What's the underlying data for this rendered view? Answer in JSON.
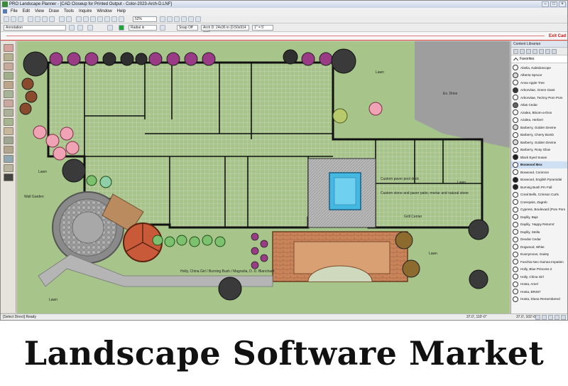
{
  "window": {
    "title": "PRO Landscape Planner - [CAD Closeup for Printed Output - Color-2023-Arch-D.LNF]",
    "controls": [
      "minimize-icon",
      "maximize-icon",
      "close-icon"
    ]
  },
  "menu": [
    "File",
    "Edit",
    "View",
    "Draw",
    "Tools",
    "Inquire",
    "Window",
    "Help"
  ],
  "toolbar": {
    "zoom": "52%",
    "layer": "Annotation",
    "line_style": "Radial in",
    "snap": "Snap Off",
    "sheet": "Arch D: 24x36 in (0.50x914 mm)",
    "scale": "1\" = 5'"
  },
  "cad": {
    "exit_label": "Exit Cad"
  },
  "colors": {
    "lawn": "#a7c58b",
    "shrub_purple": "#9a3b85",
    "shrub_dark": "#2f2f2f",
    "pink": "#f0a3b5",
    "paver": "#c9845a",
    "pool": "#43b8e0",
    "title_text": "#111111"
  },
  "plan_labels": {
    "lawn_1": "Lawn",
    "lawn_2": "Lawn",
    "lawn_3": "Lawn",
    "lawn_4": "Lawn",
    "lawn_5": "Lawn",
    "drive": "Ex. Drive",
    "custom_paver": "Custom paver pool deck",
    "note": "Custom stone and paver patio; mortar and natural stone",
    "grill": "Grill Center",
    "plant_notes": "Holly, China Girl / Burning Bush / Magnolia, D. D. Blanchard",
    "wall_label": "Wall Garden"
  },
  "library": {
    "header": "Content Librarian",
    "tab": "Favorites",
    "selected": "Boxwood Box",
    "items": [
      "Abelia, Kaleidoscope",
      "Alberta Spruce",
      "Anna Apple Tree",
      "Arborvitae, Green Giant",
      "Arborvitae, Techny Pom Pom",
      "Atlas Cedar",
      "Azalea, Bloom-a-thon",
      "Azalea, Herbert",
      "Barberry, Golden Devine",
      "Barberry, Cherry Bomb",
      "Barberry, Golden Devine",
      "Barberry, Rosy Glow",
      "Black Eyed Susan",
      "Boxwood Box",
      "Boxwood, Common",
      "Boxwood, English Pyramidal",
      "Burning Bush Pm Fall",
      "Coral Bells, Crimson Curls",
      "Coreopsis, Zagreb",
      "Cypress, Boulevard (Pom Pom",
      "Daylily, Bajs",
      "Daylily, 'Happy Returns'",
      "Daylily, Stella",
      "Deodar Cedar",
      "Dogwood, White",
      "Euonymous, Gaiety",
      "Fuschia Neo Guinea Impatien",
      "Holly, Blue Princess 2",
      "Holly, China Girl",
      "Hosta, Amel",
      "Hosta, BR467",
      "Hosta, Diana Remembered"
    ]
  },
  "status": {
    "left": "[Select Direct] Ready",
    "coord1": "37.0', 110'-0\"",
    "coord2": "37.0', 102'-0\""
  },
  "caption": "Landscape Software Market"
}
